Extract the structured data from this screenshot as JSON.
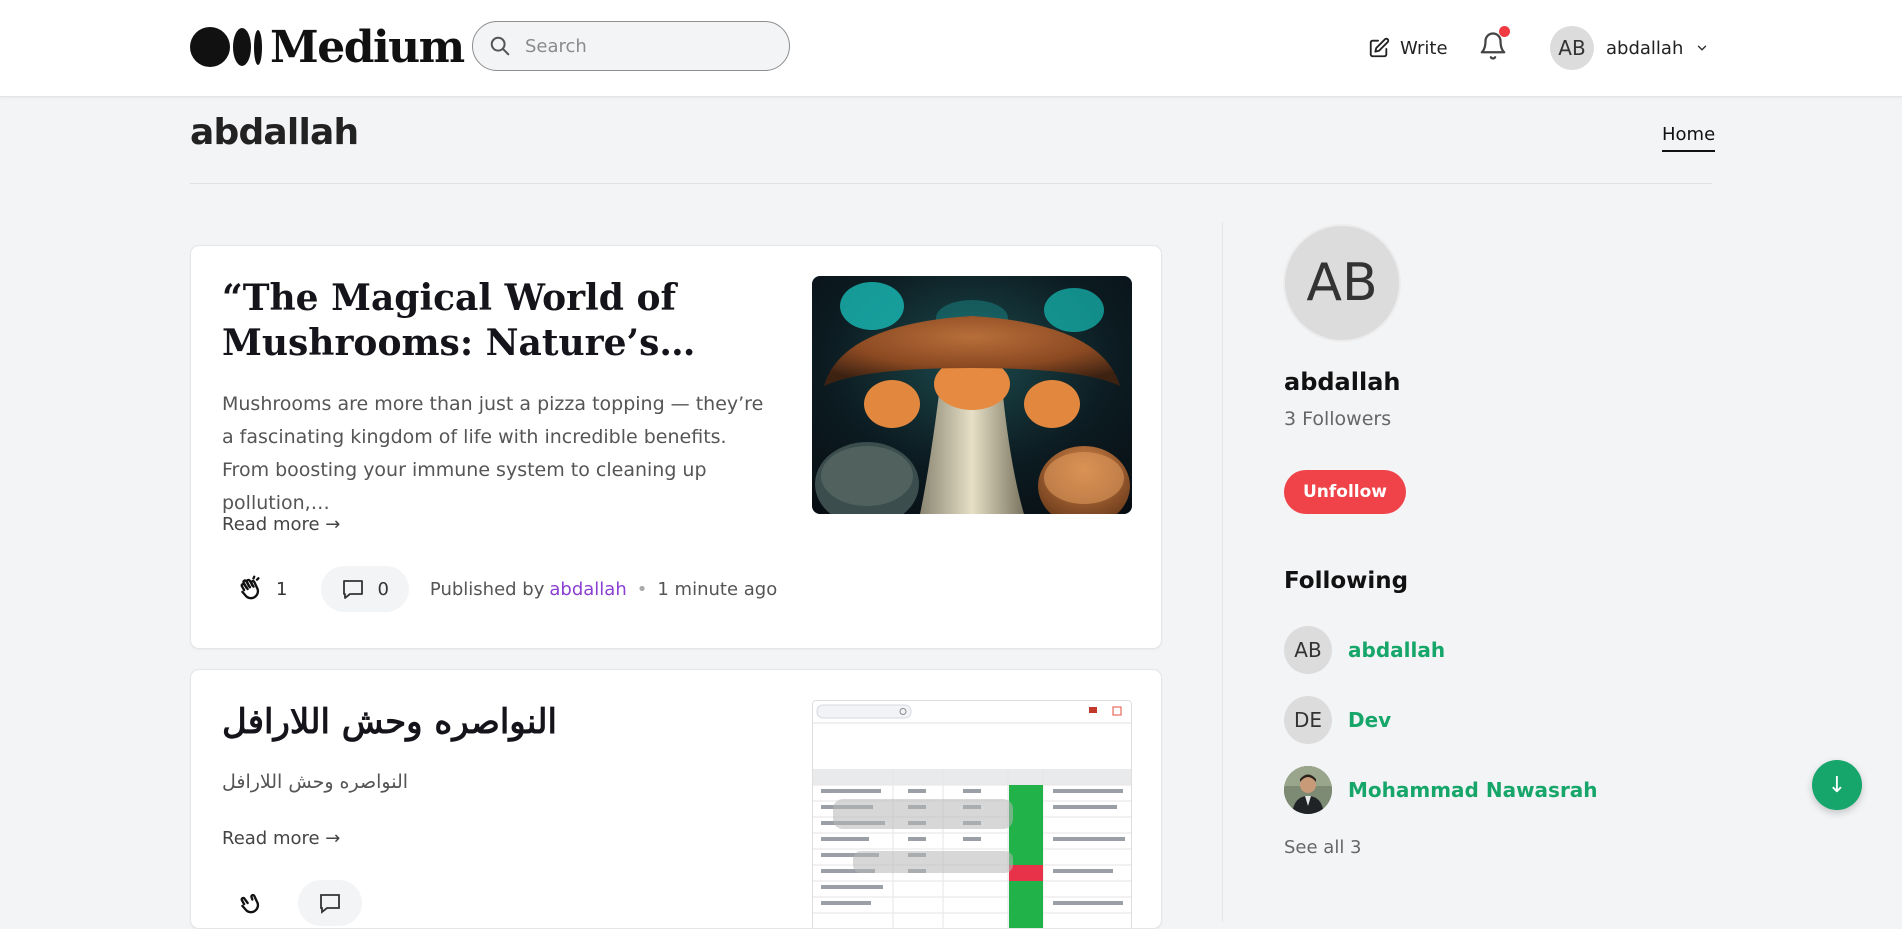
{
  "header": {
    "logo_text": "Medium",
    "search_placeholder": "Search",
    "write_label": "Write",
    "user_initials": "AB",
    "user_name": "abdallah"
  },
  "profile": {
    "name": "abdallah",
    "nav_home": "Home"
  },
  "articles": [
    {
      "title": "“The Magical World of Mushrooms: Nature’s…",
      "excerpt": "Mushrooms are more than just a pizza topping — they’re a fascinating kingdom of life with incredible benefits. From boosting your immune system to cleaning up pollution,…",
      "read_more": "Read more →",
      "claps": "1",
      "comments": "0",
      "published_by": "Published by",
      "author": "abdallah",
      "separator": "•",
      "time": "1 minute ago"
    },
    {
      "title": "النواصره وحش اللارافل",
      "excerpt": "النواصره وحش اللارافل",
      "read_more": "Read more →"
    }
  ],
  "sidebar": {
    "avatar_initials": "AB",
    "name": "abdallah",
    "followers": "3 Followers",
    "unfollow_label": "Unfollow",
    "following_title": "Following",
    "following": [
      {
        "initials": "AB",
        "name": "abdallah"
      },
      {
        "initials": "DE",
        "name": "Dev"
      },
      {
        "initials": "",
        "name": "Mohammad Nawasrah"
      }
    ],
    "see_all": "See all 3"
  },
  "fab_icon": "↓",
  "colors": {
    "accent_green": "#17a66a",
    "unfollow_red": "#ef4349",
    "author_purple": "#8a3fd1",
    "notification_dot": "#ef3b41"
  }
}
